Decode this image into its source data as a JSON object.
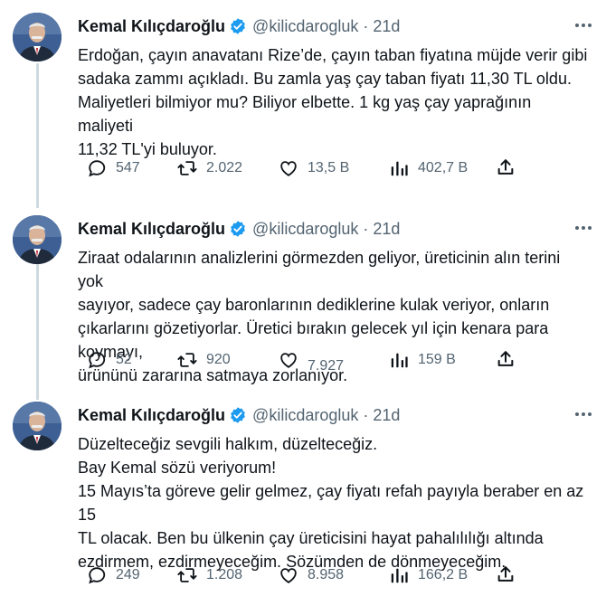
{
  "tweets": [
    {
      "author": "Kemal Kılıçdaroğlu",
      "handle": "@kilicdarogluk",
      "separator": "·",
      "time": "21d",
      "lines": [
        "Erdoğan, çayın anavatanı Rize’de, çayın taban fiyatına müjde verir gibi",
        "sadaka zammı açıkladı. Bu zamla yaş çay taban fiyatı 11,30 TL oldu.",
        "Maliyetleri bilmiyor mu? Biliyor elbette. 1 kg yaş çay yaprağının maliyeti",
        "11,32 TL'yi buluyor."
      ],
      "replies": "547",
      "retweets": "2.022",
      "likes": "13,5 B",
      "views": "402,7 B"
    },
    {
      "author": "Kemal Kılıçdaroğlu",
      "handle": "@kilicdarogluk",
      "separator": "·",
      "time": "21d",
      "lines": [
        "Ziraat odalarının analizlerini görmezden geliyor, üreticinin alın terini yok",
        "sayıyor, sadece çay baronlarının dediklerine kulak veriyor, onların",
        "çıkarlarını gözetiyorlar. Üretici bırakın gelecek yıl için kenara para koymayı,",
        "ürününü zararına satmaya zorlanıyor."
      ],
      "replies": "52",
      "retweets": "920",
      "likes": "7.927",
      "views": "159 B"
    },
    {
      "author": "Kemal Kılıçdaroğlu",
      "handle": "@kilicdarogluk",
      "separator": "·",
      "time": "21d",
      "lines": [
        "Düzelteceğiz sevgili halkım, düzelteceğiz.",
        "Bay Kemal sözü veriyorum!",
        "15 Mayıs’ta göreve gelir gelmez, çay fiyatı refah payıyla beraber en az 15",
        "TL olacak. Ben bu ülkenin çay üreticisini hayat pahalılılığı altında",
        "ezdirmem, ezdirmeyeceğim. Sözümden de dönmeyeceğim."
      ],
      "replies": "249",
      "retweets": "1.208",
      "likes": "8.958",
      "views": "166,2 B"
    }
  ],
  "icons": {
    "verified": "verified-badge-icon",
    "reply": "reply-icon",
    "retweet": "retweet-icon",
    "like": "heart-icon",
    "views": "views-chart-icon",
    "share": "share-icon",
    "more": "more-dots-icon"
  },
  "colors": {
    "text": "#0f1419",
    "secondary": "#536471",
    "verified": "#1d9bf0",
    "thread_line": "#cfd9de"
  }
}
